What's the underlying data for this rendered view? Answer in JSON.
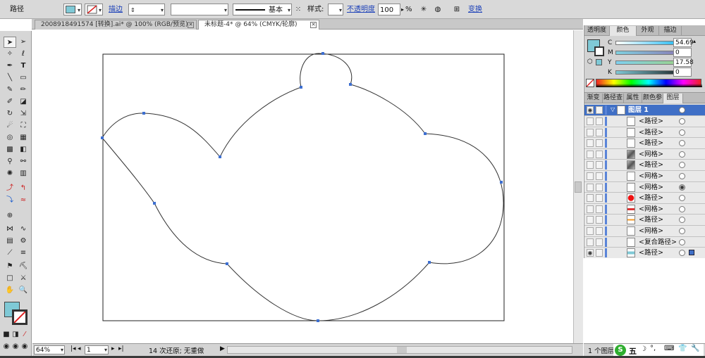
{
  "control_bar": {
    "object_type": "路径",
    "stroke_link": "描边",
    "stroke_profile": "基本",
    "style_label": "样式:",
    "opacity_link": "不透明度",
    "opacity_value": "100",
    "opacity_unit": "%",
    "transform_link": "变换",
    "fill_color": "#7fc9d6"
  },
  "tabs": [
    {
      "label": "2008918491574 [转换].ai* @ 100% (RGB/预览)",
      "close": "✕",
      "active": false
    },
    {
      "label": "未标题-4* @ 64% (CMYK/轮廓)",
      "close": "✕",
      "active": true
    }
  ],
  "status": {
    "zoom": "64%",
    "page": "1",
    "undo_text": "14 次还原; 无重做"
  },
  "color_panel": {
    "tabs": [
      "透明度",
      "颜色",
      "外观",
      "描边"
    ],
    "active_tab": "颜色",
    "channels": [
      {
        "label": "C",
        "value": "54.69"
      },
      {
        "label": "M",
        "value": "0"
      },
      {
        "label": "Y",
        "value": "17.58"
      },
      {
        "label": "K",
        "value": "0"
      }
    ],
    "swatch_color": "#7fc9d6"
  },
  "layers_panel": {
    "tabs": [
      "渐变",
      "路径查",
      "属性",
      "颜色参",
      "图层"
    ],
    "active_tab": "图层",
    "layer_name": "图层 1",
    "items": [
      {
        "name": "<路径>",
        "thumb": "blank"
      },
      {
        "name": "<路径>",
        "thumb": "blank"
      },
      {
        "name": "<路径>",
        "thumb": "blank"
      },
      {
        "name": "<网格>",
        "thumb": "gray"
      },
      {
        "name": "<路径>",
        "thumb": "gray"
      },
      {
        "name": "<网格>",
        "thumb": "blank"
      },
      {
        "name": "<网格>",
        "thumb": "blank"
      },
      {
        "name": "<路径>",
        "thumb": "red"
      },
      {
        "name": "<网格>",
        "thumb": "redstroke"
      },
      {
        "name": "<路径>",
        "thumb": "orange"
      },
      {
        "name": "<网格>",
        "thumb": "blank"
      },
      {
        "name": "<复合路径>",
        "thumb": "blank"
      },
      {
        "name": "<路径>",
        "thumb": "teal"
      }
    ],
    "count_text": "1 个图层"
  },
  "ime_bar": {
    "items": [
      "S",
      "五",
      "☽",
      "°,",
      "⌨",
      "👕",
      "🔧"
    ]
  },
  "icons": {
    "select": "selection-arrow-icon",
    "direct_select": "direct-selection-icon",
    "pen": "pen-icon",
    "type": "type-icon"
  }
}
